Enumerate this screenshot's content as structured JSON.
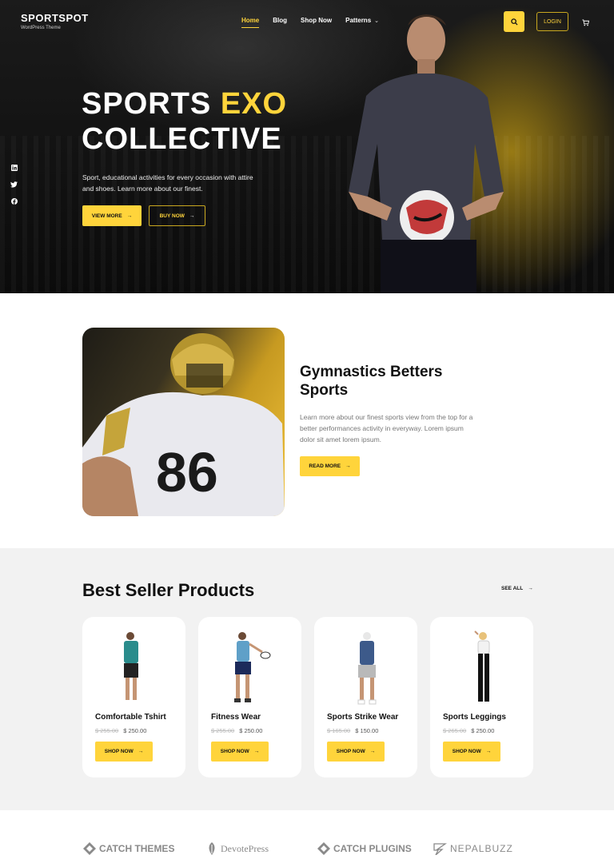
{
  "header": {
    "brand_title": "SPORTSPOT",
    "brand_tagline": "WordPress Theme",
    "nav": [
      {
        "label": "Home",
        "active": true
      },
      {
        "label": "Blog"
      },
      {
        "label": "Shop Now"
      },
      {
        "label": "Patterns",
        "has_dropdown": true
      }
    ],
    "login_label": "LOGIN",
    "icons": {
      "search": "search-icon",
      "cart": "cart-icon"
    }
  },
  "social": [
    "linkedin-icon",
    "twitter-icon",
    "facebook-icon"
  ],
  "hero": {
    "title_part1": "SPORTS",
    "title_highlight": "EXO",
    "title_line2": "COLLECTIVE",
    "description": "Sport, educational activities for every occasion with attire and shoes. Learn more about our finest.",
    "primary_button": "VIEW MORE",
    "secondary_button": "BUY NOW"
  },
  "feature": {
    "title": "Gymnastics Betters Sports",
    "description": "Learn more about our finest sports view from the top for a better performances activity in everyway. Lorem ipsum dolor sit amet lorem ipsum.",
    "button": "READ MORE"
  },
  "products": {
    "title": "Best Seller Products",
    "see_all": "SEE ALL",
    "items": [
      {
        "name": "Comfortable Tshirt",
        "old_price": "$ 255.00",
        "price": "$ 250.00",
        "button": "SHOP NOW"
      },
      {
        "name": "Fitness Wear",
        "old_price": "$ 255.00",
        "price": "$ 250.00",
        "button": "SHOP NOW"
      },
      {
        "name": "Sports Strike Wear",
        "old_price": "$ 165.00",
        "price": "$ 150.00",
        "button": "SHOP NOW"
      },
      {
        "name": "Sports Leggings",
        "old_price": "$ 265.00",
        "price": "$ 250.00",
        "button": "SHOP NOW"
      }
    ]
  },
  "partners": [
    {
      "name": "CATCH THEMES"
    },
    {
      "name": "DevotePress"
    },
    {
      "name": "CATCH PLUGINS"
    },
    {
      "name": "NEPALBUZZ"
    }
  ],
  "colors": {
    "accent": "#ffd43b",
    "dark": "#121212",
    "light_bg": "#f2f2f2"
  }
}
